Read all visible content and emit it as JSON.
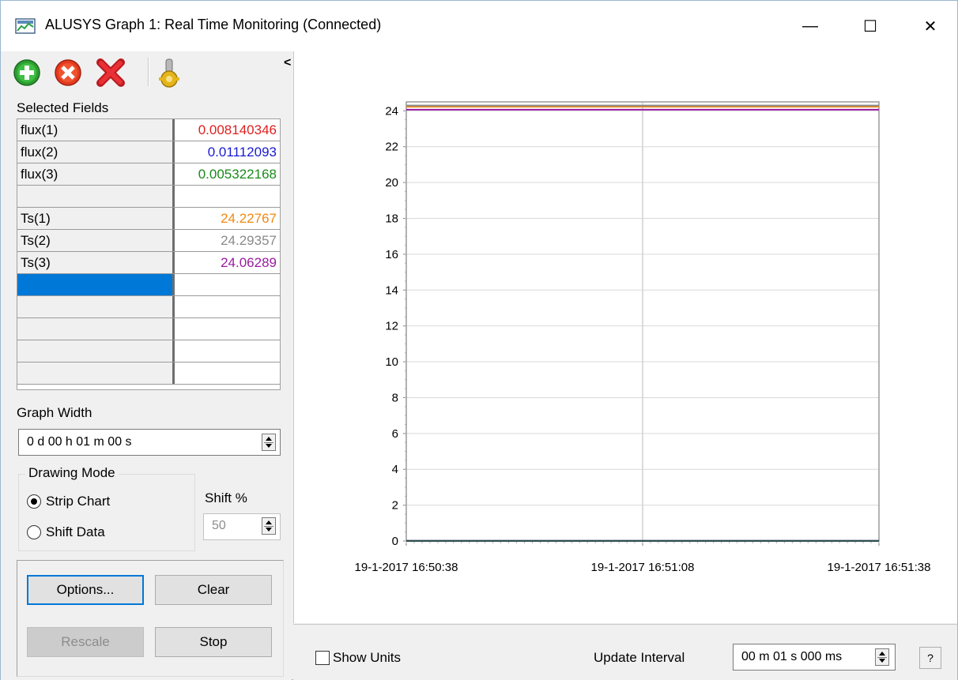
{
  "window": {
    "title": "ALUSYS Graph 1: Real Time Monitoring (Connected)",
    "minimize_glyph": "—",
    "maximize_glyph": "☐",
    "close_glyph": "✕"
  },
  "toolbar": {
    "buttons": [
      {
        "icon": "add-icon",
        "color": "#2e9e32"
      },
      {
        "icon": "remove-icon",
        "color": "#e23b1f"
      },
      {
        "icon": "delete-all-icon",
        "color": "#d9262b"
      },
      {
        "icon": "settings-icon",
        "color": "#e5b51a"
      }
    ],
    "collapse_label": "<"
  },
  "selected_fields": {
    "label": "Selected Fields",
    "rows": [
      {
        "name": "flux(1)",
        "value": "0.008140346",
        "color": "#e02020"
      },
      {
        "name": "flux(2)",
        "value": "0.01112093",
        "color": "#1a1ad0"
      },
      {
        "name": "flux(3)",
        "value": "0.005322168",
        "color": "#1a8a1a"
      },
      {
        "name": "",
        "value": "",
        "color": "#000000"
      },
      {
        "name": "Ts(1)",
        "value": "24.22767",
        "color": "#f08a10"
      },
      {
        "name": "Ts(2)",
        "value": "24.29357",
        "color": "#8a8a8a"
      },
      {
        "name": "Ts(3)",
        "value": "24.06289",
        "color": "#9a1aa0"
      },
      {
        "name": "",
        "value": "",
        "color": "#000000",
        "selected": true
      },
      {
        "name": "",
        "value": "",
        "color": "#000000"
      },
      {
        "name": "",
        "value": "",
        "color": "#000000"
      },
      {
        "name": "",
        "value": "",
        "color": "#000000"
      },
      {
        "name": "",
        "value": "",
        "color": "#000000"
      }
    ]
  },
  "graph_width": {
    "label": "Graph Width",
    "value": "0 d 00 h 01 m 00 s"
  },
  "drawing_mode": {
    "label": "Drawing Mode",
    "options": [
      "Strip Chart",
      "Shift Data"
    ],
    "selected": "Strip Chart"
  },
  "shift": {
    "label": "Shift %",
    "value": "50"
  },
  "buttons": {
    "options": "Options...",
    "clear": "Clear",
    "rescale": "Rescale",
    "stop": "Stop"
  },
  "bottom": {
    "show_units": "Show Units",
    "update_interval_label": "Update Interval",
    "update_interval_value": "00 m 01 s 000 ms",
    "help": "?"
  },
  "chart_data": {
    "type": "line",
    "title": "",
    "xlabel": "",
    "ylabel": "",
    "ylim": [
      0,
      24.5
    ],
    "yticks": [
      0,
      2,
      4,
      6,
      8,
      10,
      12,
      14,
      16,
      18,
      20,
      22,
      24
    ],
    "xticks": [
      "19-1-2017 16:50:38",
      "19-1-2017 16:51:08",
      "19-1-2017 16:51:38"
    ],
    "x": [
      "19-1-2017 16:50:38",
      "19-1-2017 16:51:38"
    ],
    "grid": true,
    "series": [
      {
        "name": "flux(1)",
        "color": "#e02020",
        "values": [
          0.008140346,
          0.008140346
        ]
      },
      {
        "name": "flux(2)",
        "color": "#1a1ad0",
        "values": [
          0.01112093,
          0.01112093
        ]
      },
      {
        "name": "flux(3)",
        "color": "#1a8a1a",
        "values": [
          0.005322168,
          0.005322168
        ]
      },
      {
        "name": "Ts(1)",
        "color": "#f08a10",
        "values": [
          24.22767,
          24.22767
        ]
      },
      {
        "name": "Ts(2)",
        "color": "#8a8a8a",
        "values": [
          24.29357,
          24.29357
        ]
      },
      {
        "name": "Ts(3)",
        "color": "#9a1aa0",
        "values": [
          24.06289,
          24.06289
        ]
      }
    ]
  }
}
